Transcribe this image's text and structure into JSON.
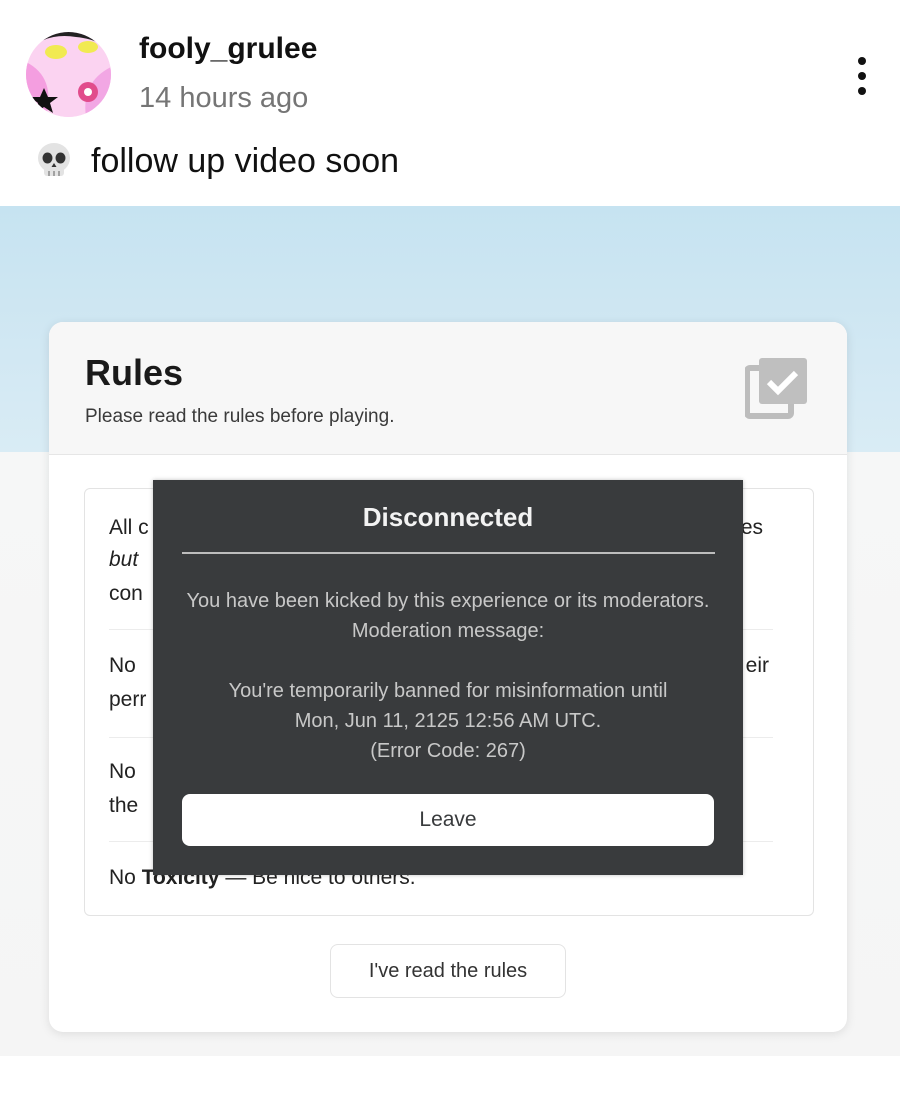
{
  "post": {
    "username": "fooly_grulee",
    "time": "14 hours ago",
    "caption": "follow up video soon",
    "caption_emoji": "skull-icon"
  },
  "rules": {
    "title": "Rules",
    "subtitle": "Please read the rules before playing.",
    "rows": [
      {
        "lead": "All c",
        "tail": "es"
      },
      {
        "lead": "but",
        "tail": ""
      },
      {
        "lead": "con",
        "tail": ""
      },
      {
        "lead": "No ",
        "tail": "eir"
      },
      {
        "lead": "perr",
        "tail": ""
      },
      {
        "lead": "No ",
        "tail": ""
      },
      {
        "lead": "the",
        "tail": ""
      },
      {
        "lead": "No ",
        "bold": "Toxicity",
        "rest": " — Be nice to others."
      }
    ],
    "button": "I've read the rules"
  },
  "dialog": {
    "title": "Disconnected",
    "message1": "You have been kicked by this experience or its moderators. Moderation message:",
    "message2_l1": "You're temporarily banned for misinformation until",
    "message2_l2": "Mon, Jun 11, 2125 12:56 AM UTC.",
    "message2_l3": "(Error Code: 267)",
    "button": "Leave"
  }
}
